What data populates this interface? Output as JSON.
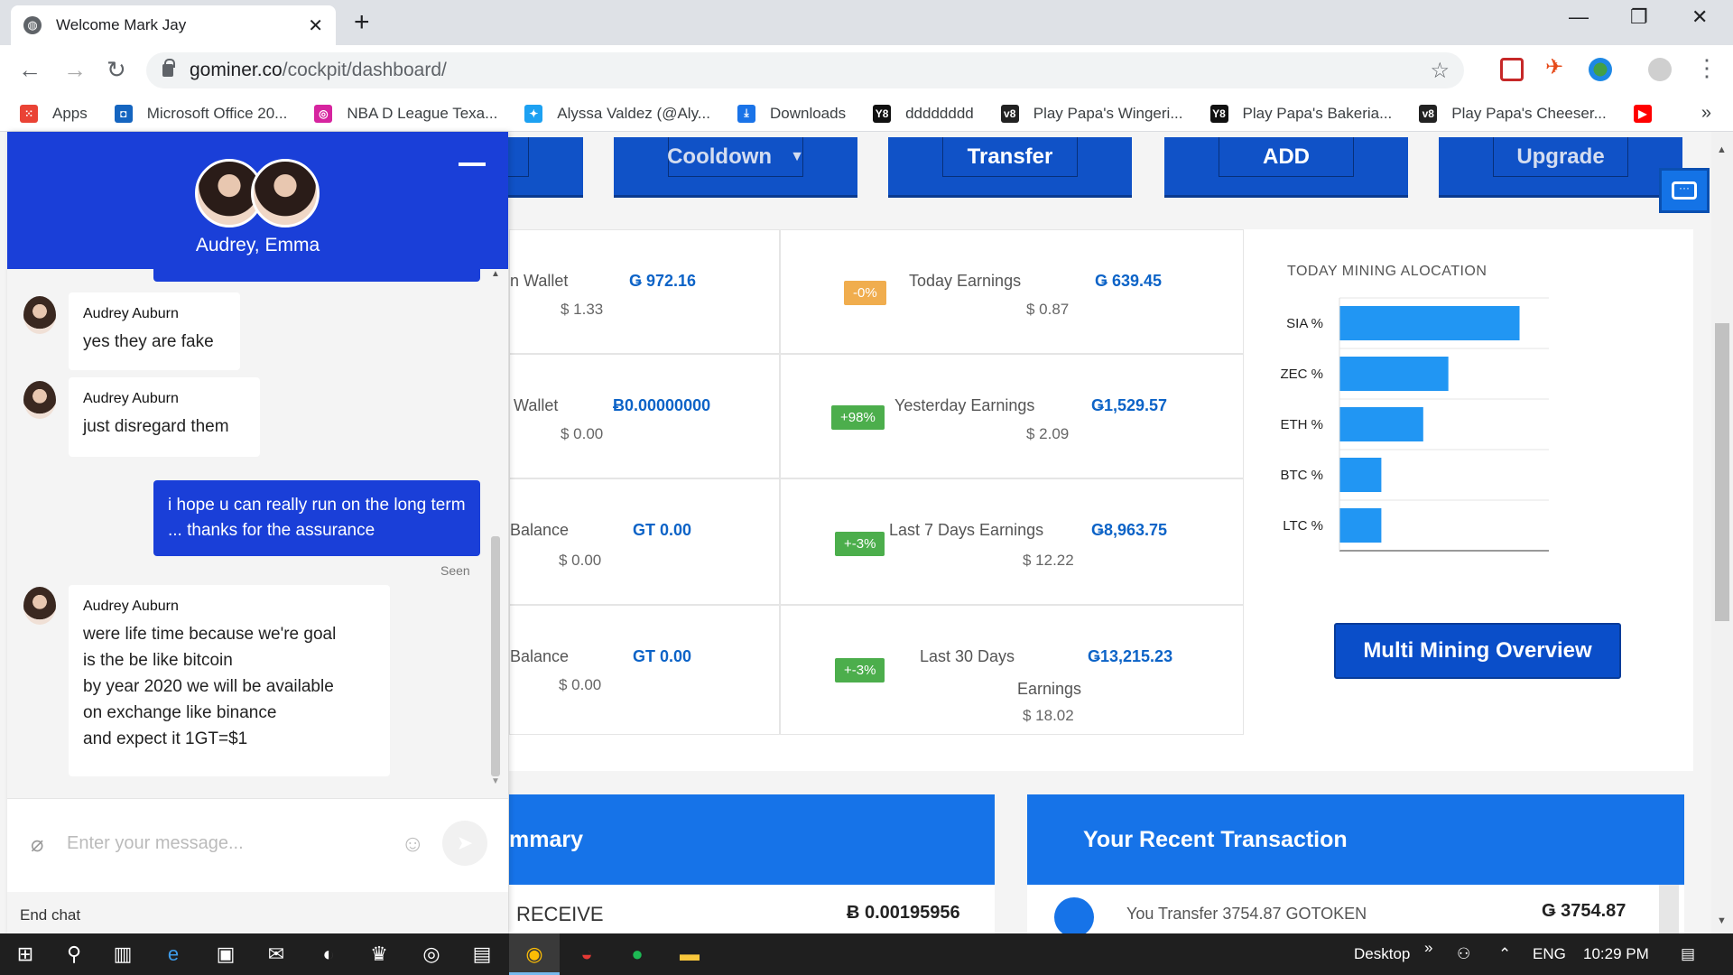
{
  "browser": {
    "tab_title": "Welcome Mark Jay",
    "url_host": "gominer.co",
    "url_path": "/cockpit/dashboard/",
    "bookmarks": [
      {
        "label": "Apps",
        "icon": "apps-grid-icon",
        "color": "#ea4335"
      },
      {
        "label": "Microsoft Office 20...",
        "icon": "office-icon",
        "color": "#1565c0"
      },
      {
        "label": "NBA D League Texa...",
        "icon": "instagram-icon",
        "color": "#d6249f"
      },
      {
        "label": "Alyssa Valdez (@Aly...",
        "icon": "twitter-icon",
        "color": "#1da1f2"
      },
      {
        "label": "Downloads",
        "icon": "download-icon",
        "color": "#1a73e8"
      },
      {
        "label": "dddddddd",
        "icon": "y8-icon",
        "color": "#111111"
      },
      {
        "label": "Play Papa's Wingeri...",
        "icon": "v8-icon",
        "color": "#222222"
      },
      {
        "label": "Play Papa's Bakeria...",
        "icon": "y8-icon",
        "color": "#111111"
      },
      {
        "label": "Play Papa's Cheeser...",
        "icon": "v8-icon",
        "color": "#222222"
      }
    ]
  },
  "top_buttons": [
    "Cooldown",
    "Transfer",
    "ADD",
    "Upgrade"
  ],
  "stats": {
    "col1": [
      {
        "label": "n Wallet",
        "value": "Ǥ 972.16",
        "usd": "$ 1.33"
      },
      {
        "label": "Wallet",
        "value": "Ƀ0.00000000",
        "usd": "$ 0.00"
      },
      {
        "label": "Balance",
        "value": "GT 0.00",
        "usd": "$ 0.00"
      },
      {
        "label": "Balance",
        "value": "GT 0.00",
        "usd": "$ 0.00"
      }
    ],
    "col2": [
      {
        "badge": "-0%",
        "badge_color": "#f0ad4e",
        "label": "Today Earnings",
        "value": "Ǥ 639.45",
        "usd": "$ 0.87"
      },
      {
        "badge": "+98%",
        "badge_color": "#4cae4c",
        "label": "Yesterday Earnings",
        "value": "Ǥ1,529.57",
        "usd": "$ 2.09"
      },
      {
        "badge": "+-3%",
        "badge_color": "#4cae4c",
        "label": "Last 7 Days Earnings",
        "value": "Ǥ8,963.75",
        "usd": "$ 12.22"
      },
      {
        "badge": "+-3%",
        "badge_color": "#4cae4c",
        "label": "Last 30 Days",
        "label2": "Earnings",
        "value": "Ǥ13,215.23",
        "usd": "$ 18.02"
      }
    ]
  },
  "chart_data": {
    "type": "bar",
    "orientation": "horizontal",
    "title": "TODAY MINING ALOCATION",
    "categories": [
      "SIA %",
      "ZEC %",
      "ETH %",
      "BTC %",
      "LTC %"
    ],
    "values": [
      43,
      26,
      20,
      10,
      10
    ],
    "xlim": [
      0,
      50
    ],
    "color": "#2196f3",
    "grid": true,
    "legend": "none"
  },
  "multi_mining_button": "Multi Mining Overview",
  "summary": {
    "title": "mmary",
    "row_label": "RECEIVE",
    "row_value": "Ƀ 0.00195956"
  },
  "transactions": {
    "title": "Your Recent Transaction",
    "row_label": "You Transfer 3754.87 GOTOKEN",
    "row_value": "Ǥ 3754.87"
  },
  "chat": {
    "names": "Audrey, Emma",
    "messages": [
      {
        "from": "Audrey Auburn",
        "text": "yes they are fake"
      },
      {
        "from": "Audrey Auburn",
        "text": "just disregard them"
      },
      {
        "from": "me",
        "text": "i hope u can really run on the long term ... thanks for the assurance"
      },
      {
        "from": "Audrey Auburn",
        "lines": [
          "were life time because we're goal",
          "is the be like bitcoin",
          "by year 2020 we will be available",
          "on exchange like binance",
          "and expect it 1GT=$1"
        ]
      }
    ],
    "seen": "Seen",
    "placeholder": "Enter your message...",
    "end_chat": "End chat"
  },
  "taskbar": {
    "desktop": "Desktop",
    "lang": "ENG",
    "time": "10:29 PM"
  }
}
